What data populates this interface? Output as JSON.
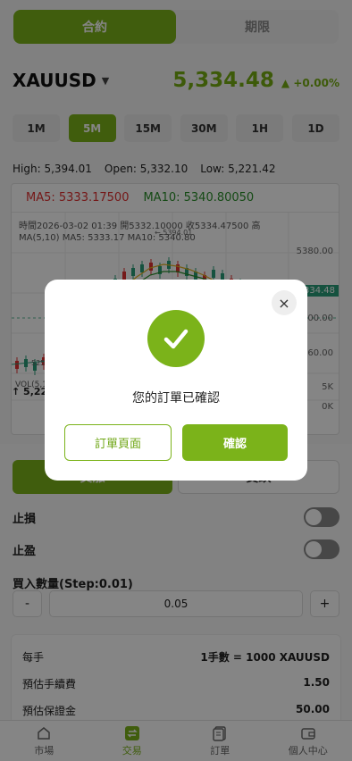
{
  "top_tabs": [
    "合約",
    "期限"
  ],
  "symbol": {
    "name": "XAUUSD",
    "caret": "▼"
  },
  "price": {
    "value": "5,334.48",
    "change": "▲ +0.00%"
  },
  "timeframes": [
    "1M",
    "5M",
    "15M",
    "30M",
    "1H",
    "1D"
  ],
  "active_timeframe": "5M",
  "hol": {
    "high": "High: 5,394.01",
    "open": "Open: 5,332.10",
    "low": "Low: 5,221.42"
  },
  "chart": {
    "ma5": "MA5: 5333.17500",
    "ma10": "MA10: 5340.80050",
    "info_line1": "時間2026-03-02 01:39   開5332.10000   收5334.47500   高",
    "info_line2": "MA(5,10)     MA5: 5333.17   MA10: 5340.80",
    "y_labels": [
      "5380.00",
      "300.00",
      "260.00"
    ],
    "price_tag": "334.48",
    "high_mark": "← 5394.01",
    "low_mark": "525",
    "vol_label": "VOL(5,10)",
    "vol_value": "↑ 5,22",
    "vol_axis": [
      "5K",
      "0K"
    ]
  },
  "buysell": [
    "買漲",
    "賣跌"
  ],
  "stop_loss": "止損",
  "take_profit": "止盈",
  "qty": {
    "label": "買入數量(Step:0.01)",
    "value": "0.05",
    "minus": "-",
    "plus": "+"
  },
  "details": [
    {
      "label": "每手",
      "value": "1手數 = 1000 XAUUSD"
    },
    {
      "label": "預估手續費",
      "value": "1.50"
    },
    {
      "label": "預估保證金",
      "value": "50.00"
    }
  ],
  "tabbar": [
    {
      "label": "市場",
      "icon": "home-icon"
    },
    {
      "label": "交易",
      "icon": "exchange-icon"
    },
    {
      "label": "訂單",
      "icon": "orders-icon"
    },
    {
      "label": "個人中心",
      "icon": "wallet-icon"
    }
  ],
  "modal": {
    "message": "您的訂單已確認",
    "order_page_button": "訂單頁面",
    "confirm_button": "確認",
    "close": "×"
  },
  "colors": {
    "accent": "#7bb31a",
    "up": "#2a9d7a",
    "down": "#e03030"
  }
}
